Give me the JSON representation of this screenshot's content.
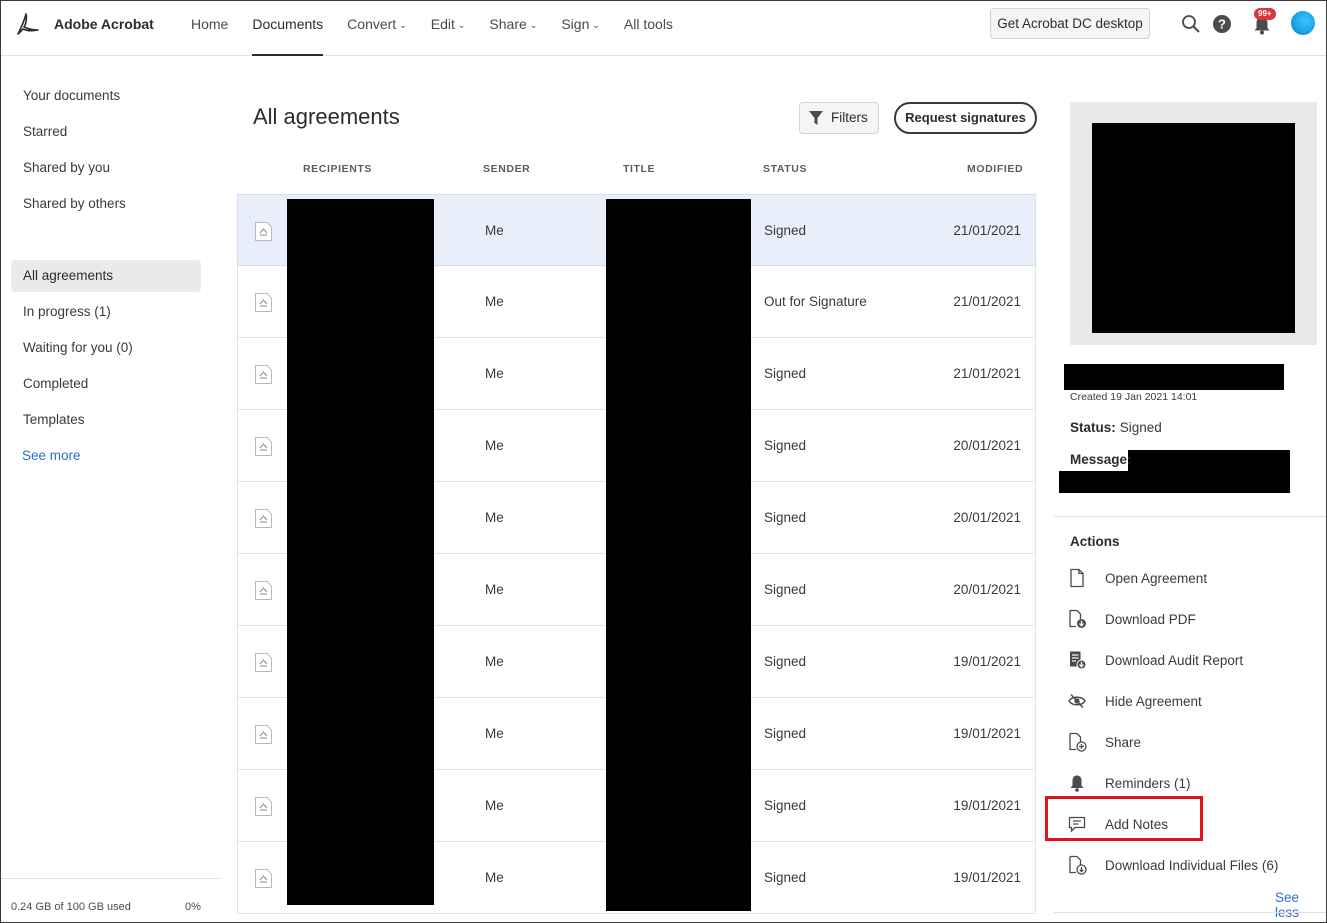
{
  "app": {
    "brand": "Adobe Acrobat"
  },
  "nav": {
    "items": [
      {
        "label": "Home",
        "dropdown": false,
        "active": false
      },
      {
        "label": "Documents",
        "dropdown": false,
        "active": true
      },
      {
        "label": "Convert",
        "dropdown": true,
        "active": false
      },
      {
        "label": "Edit",
        "dropdown": true,
        "active": false
      },
      {
        "label": "Share",
        "dropdown": true,
        "active": false
      },
      {
        "label": "Sign",
        "dropdown": true,
        "active": false
      },
      {
        "label": "All tools",
        "dropdown": false,
        "active": false
      }
    ],
    "cta_label": "Get Acrobat DC desktop",
    "notification_badge": "99+"
  },
  "sidebar": {
    "items": [
      {
        "label": "Your documents"
      },
      {
        "label": "Starred"
      },
      {
        "label": "Shared by you"
      },
      {
        "label": "Shared by others"
      },
      {
        "label": "All agreements",
        "active": true
      },
      {
        "label": "In progress (1)"
      },
      {
        "label": "Waiting for you (0)"
      },
      {
        "label": "Completed"
      },
      {
        "label": "Templates"
      },
      {
        "label": "See more",
        "link": true
      }
    ],
    "storage": {
      "text": "0.24 GB of 100 GB used",
      "percent": "0%"
    }
  },
  "main": {
    "title": "All agreements",
    "filters_label": "Filters",
    "request_label": "Request signatures",
    "columns": [
      "RECIPIENTS",
      "SENDER",
      "TITLE",
      "STATUS",
      "MODIFIED"
    ],
    "rows": [
      {
        "sender": "Me",
        "status": "Signed",
        "modified": "21/01/2021",
        "selected": true
      },
      {
        "sender": "Me",
        "status": "Out for Signature",
        "modified": "21/01/2021"
      },
      {
        "sender": "Me",
        "status": "Signed",
        "modified": "21/01/2021"
      },
      {
        "sender": "Me",
        "status": "Signed",
        "modified": "20/01/2021"
      },
      {
        "sender": "Me",
        "status": "Signed",
        "modified": "20/01/2021"
      },
      {
        "sender": "Me",
        "status": "Signed",
        "modified": "20/01/2021"
      },
      {
        "sender": "Me",
        "status": "Signed",
        "modified": "19/01/2021"
      },
      {
        "sender": "Me",
        "status": "Signed",
        "modified": "19/01/2021"
      },
      {
        "sender": "Me",
        "status": "Signed",
        "modified": "19/01/2021"
      },
      {
        "sender": "Me",
        "status": "Signed",
        "modified": "19/01/2021"
      }
    ]
  },
  "details": {
    "created": "Created 19 Jan 2021 14:01",
    "status_label": "Status:",
    "status_value": "Signed",
    "message_label": "Message:",
    "actions_title": "Actions",
    "actions": [
      {
        "label": "Open Agreement",
        "icon": "document-icon"
      },
      {
        "label": "Download PDF",
        "icon": "download-pdf-icon"
      },
      {
        "label": "Download Audit Report",
        "icon": "audit-report-icon"
      },
      {
        "label": "Hide Agreement",
        "icon": "hide-eye-icon"
      },
      {
        "label": "Share",
        "icon": "share-document-icon"
      },
      {
        "label": "Reminders (1)",
        "icon": "bell-icon"
      },
      {
        "label": "Add Notes",
        "icon": "comment-icon"
      },
      {
        "label": "Download Individual Files (6)",
        "icon": "download-files-icon"
      }
    ],
    "see_less": "See less"
  },
  "colors": {
    "accent_blue": "#2d6ec9",
    "badge_red": "#d7373f",
    "highlight_red": "#e0151b",
    "selected_row": "#e9eefb"
  }
}
